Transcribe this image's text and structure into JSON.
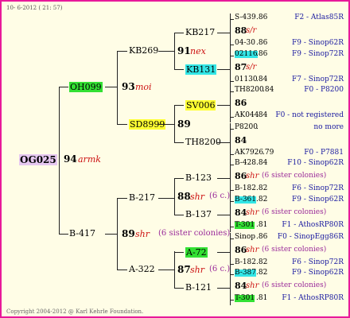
{
  "header": {
    "date_text": "10-  6-2012 ( 21: 57)"
  },
  "root": {
    "code": "OG025",
    "number": "94",
    "tag": "armk",
    "bg": "#e6c8f0"
  },
  "gen1": [
    {
      "code": "OH099",
      "number": "93",
      "tag": "moi",
      "bg": "#33e033"
    },
    {
      "code": "B-417",
      "number": "89",
      "tag": "shr",
      "note": "(6 sister colonies)"
    }
  ],
  "gen2": [
    {
      "code": "KB269",
      "number": "91",
      "tag": "nex"
    },
    {
      "code": "SD8999",
      "number": "89",
      "bg": "#ffff33"
    },
    {
      "code": "B-217",
      "number": "88",
      "tag": "shr",
      "note": "(6 c.)"
    },
    {
      "code": "A-322",
      "number": "87",
      "tag": "shr",
      "note": "(6 c.)"
    }
  ],
  "gen3": [
    {
      "code": "KB217"
    },
    {
      "code": "KB131",
      "bg": "#33e6e6"
    },
    {
      "code": "SV006",
      "bg": "#ffff33"
    },
    {
      "code": "TH8200"
    },
    {
      "code": "B-123"
    },
    {
      "code": "B-137"
    },
    {
      "code": "A-72",
      "bg": "#33e033"
    },
    {
      "code": "B-121"
    }
  ],
  "gen4": [
    {
      "code": "S-439",
      "val": ".86",
      "right": "F2 - Atlas85R"
    },
    {
      "number": "88",
      "tag": "s/r"
    },
    {
      "code": "04-30",
      "val": ".86",
      "right": "F9 - Sinop62R"
    },
    {
      "code": "02116",
      "val": ".86",
      "right": "F9 - Sinop72R",
      "bg": "#33e6e6"
    },
    {
      "number": "87",
      "tag": "s/r"
    },
    {
      "code": "01130",
      "val": ".84",
      "right": "F7 - Sinop72R"
    },
    {
      "code": "TH8200",
      "val": ".84",
      "right": "F0 - P8200"
    },
    {
      "number": "86"
    },
    {
      "code": "AK044",
      "val": ".84",
      "right": "F0 - not registered"
    },
    {
      "code": "P8200",
      "val": ".",
      "right": "no more"
    },
    {
      "number": "84"
    },
    {
      "code": "AK7926",
      "val": ".79",
      "right": "F0 - P7881"
    },
    {
      "code": "B-428",
      "val": ".84",
      "right": "F10 - Sinop62R"
    },
    {
      "number": "86",
      "tag": "shr",
      "note": "(6 sister colonies)"
    },
    {
      "code": "B-182",
      "val": ".82",
      "right": "F6 - Sinop72R"
    },
    {
      "code": "B-361",
      "val": ".82",
      "right": "F9 - Sinop62R",
      "bg": "#33e6e6"
    },
    {
      "number": "84",
      "tag": "shr",
      "note": "(6 sister colonies)"
    },
    {
      "code": "T-301",
      "val": ".81",
      "right": "F1 - AthosRP80R",
      "bg": "#33e033"
    },
    {
      "code": "Sinop",
      "val": ".86",
      "right": "F0 - SinopEgg86R"
    },
    {
      "number": "86",
      "tag": "shr",
      "note": "(6 sister colonies)"
    },
    {
      "code": "B-182",
      "val": ".82",
      "right": "F6 - Sinop72R"
    },
    {
      "code": "B-387",
      "val": ".82",
      "right": "F9 - Sinop62R",
      "bg": "#33e6e6"
    },
    {
      "number": "84",
      "tag": "shr",
      "note": "(6 sister colonies)"
    },
    {
      "code": "T-301",
      "val": ".81",
      "right": "F1 - AthosRP80R",
      "bg": "#33e033"
    }
  ],
  "footer": {
    "copyright": "Copyright 2004-2012 @ Karl Kehrle Foundation."
  }
}
